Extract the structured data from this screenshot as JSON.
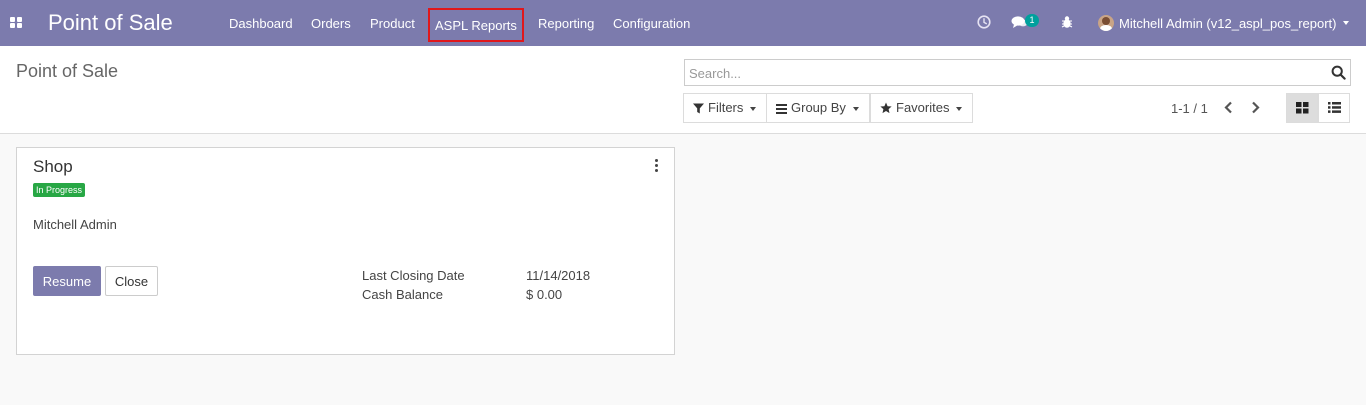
{
  "navbar": {
    "brand": "Point of Sale",
    "menu": [
      {
        "label": "Dashboard"
      },
      {
        "label": "Orders"
      },
      {
        "label": "Product"
      },
      {
        "label": "ASPL Reports"
      },
      {
        "label": "Reporting"
      },
      {
        "label": "Configuration"
      }
    ],
    "highlight_color": "#e0171c",
    "chat_badge": "1",
    "user_label": "Mitchell Admin (v12_aspl_pos_report)"
  },
  "control_panel": {
    "title": "Point of Sale",
    "search_placeholder": "Search...",
    "filters_label": "Filters",
    "groupby_label": "Group By",
    "favorites_label": "Favorites",
    "pager": "1-1 / 1",
    "active_view": "kanban"
  },
  "card": {
    "title": "Shop",
    "status": "In Progress",
    "user": "Mitchell Admin",
    "resume_label": "Resume",
    "close_label": "Close",
    "info": [
      {
        "label": "Last Closing Date",
        "value": "11/14/2018"
      },
      {
        "label": "Cash Balance",
        "value": "$ 0.00"
      }
    ]
  },
  "colors": {
    "brand": "#7c7bad",
    "status_green": "#28a745",
    "badge_teal": "#00a09d"
  },
  "icons": [
    "apps-icon",
    "clock-icon",
    "chat-icon",
    "bug-icon",
    "avatar",
    "search-icon",
    "filter-icon",
    "groupby-icon",
    "star-icon",
    "chevron-left-icon",
    "chevron-right-icon",
    "kanban-icon",
    "list-icon",
    "kebab-menu-icon"
  ]
}
